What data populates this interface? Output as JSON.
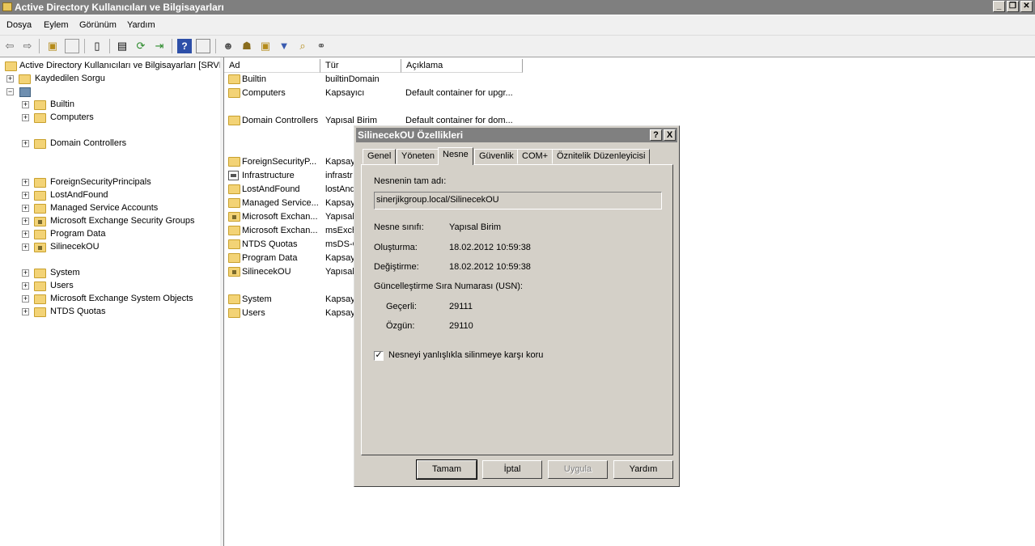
{
  "window": {
    "title": "Active Directory Kullanıcıları ve Bilgisayarları"
  },
  "menu": [
    "Dosya",
    "Eylem",
    "Görünüm",
    "Yardım"
  ],
  "toolbar_icons": [
    "back-arrow-icon",
    "forward-arrow-icon",
    "up-folder-icon",
    "show-hide-tree-icon",
    "delete-icon",
    "properties-icon",
    "refresh-icon",
    "export-list-icon",
    "help-icon",
    "action-pane-icon",
    "new-user-icon",
    "new-group-icon",
    "new-ou-icon",
    "filter-icon",
    "find-icon",
    "add-to-group-icon"
  ],
  "tree": {
    "root": "Active Directory Kullanıcıları ve Bilgisayarları [SRVDC",
    "saved_queries": "Kaydedilen Sorgu",
    "items": [
      "Builtin",
      "Computers",
      "Domain Controllers",
      "ForeignSecurityPrincipals",
      "LostAndFound",
      "Managed Service Accounts",
      "Microsoft Exchange Security Groups",
      "Program Data",
      "SilinecekOU",
      "System",
      "Users",
      "Microsoft Exchange System Objects",
      "NTDS Quotas"
    ]
  },
  "list": {
    "columns": [
      "Ad",
      "Tür",
      "Açıklama"
    ],
    "rows": [
      {
        "name": "Builtin",
        "type": "builtinDomain",
        "desc": ""
      },
      {
        "name": "Computers",
        "type": "Kapsayıcı",
        "desc": "Default container for upgr..."
      },
      {
        "name": "Domain Controllers",
        "type": "Yapısal Birim",
        "desc": "Default container for dom..."
      },
      {
        "name": "ForeignSecurityP...",
        "type": "Kapsay",
        "desc": ""
      },
      {
        "name": "Infrastructure",
        "type": "infrastr",
        "desc": ""
      },
      {
        "name": "LostAndFound",
        "type": "lostAnd",
        "desc": ""
      },
      {
        "name": "Managed Service...",
        "type": "Kapsay",
        "desc": ""
      },
      {
        "name": "Microsoft Exchan...",
        "type": "Yapısal",
        "desc": ""
      },
      {
        "name": "Microsoft Exchan...",
        "type": "msExch",
        "desc": ""
      },
      {
        "name": "NTDS Quotas",
        "type": "msDS-Q",
        "desc": ""
      },
      {
        "name": "Program Data",
        "type": "Kapsay",
        "desc": ""
      },
      {
        "name": "SilinecekOU",
        "type": "Yapısal",
        "desc": ""
      },
      {
        "name": "System",
        "type": "Kapsay",
        "desc": ""
      },
      {
        "name": "Users",
        "type": "Kapsay",
        "desc": ""
      }
    ]
  },
  "dialog": {
    "title": "SilinecekOU Özellikleri",
    "help": "?",
    "close": "X",
    "tabs": [
      "Genel",
      "Yöneten",
      "Nesne",
      "Güvenlik",
      "COM+",
      "Öznitelik Düzenleyicisi"
    ],
    "selected_tab": "Nesne",
    "fullname_label": "Nesnenin tam adı:",
    "fullname_value": "sinerjikgroup.local/SilinecekOU",
    "class_label": "Nesne sınıfı:",
    "class_value": "Yapısal Birim",
    "created_label": "Oluşturma:",
    "created_value": "18.02.2012 10:59:38",
    "modified_label": "Değiştirme:",
    "modified_value": "18.02.2012 10:59:38",
    "usn_label": "Güncelleştirme Sıra Numarası (USN):",
    "current_label": "Geçerli:",
    "current_value": "29111",
    "original_label": "Özgün:",
    "original_value": "29110",
    "protect_label": "Nesneyi yanlışlıkla silinmeye karşı koru",
    "protect_checked": true,
    "buttons": {
      "ok": "Tamam",
      "cancel": "İptal",
      "apply": "Uygula",
      "help": "Yardım"
    }
  },
  "caption_buttons": {
    "min": "_",
    "restore": "❐",
    "close": "✕"
  }
}
